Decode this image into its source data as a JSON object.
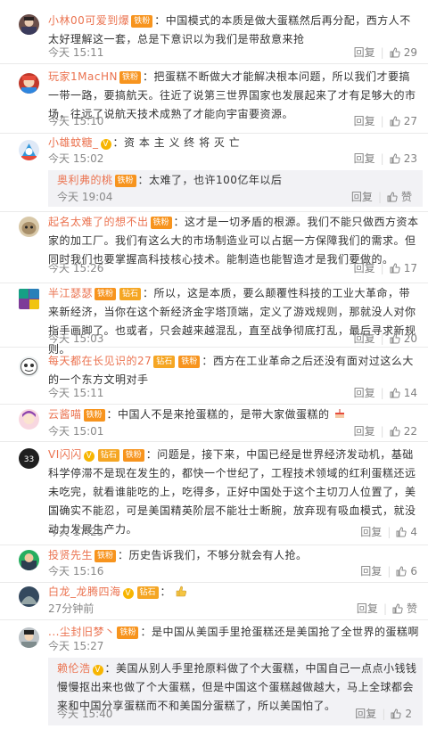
{
  "like_label": "赞",
  "reply_label": "回复",
  "sep": "|",
  "comments": [
    {
      "user": "小林00可爱到爆",
      "badge": "铁粉",
      "text": "：中国模式的本质是做大蛋糕然后再分配，西方人不太好理解这一套，总是下意识以为我们是带敌意来抢",
      "time": "今天 15:11",
      "likes": "29"
    },
    {
      "user": "玩家1MacHN",
      "badge": "铁粉",
      "text": "：把蛋糕不断做大才能解决根本问题，所以我们才要搞一带一路，要搞航天。往近了说第三世界国家也发展起来了才有足够大的市场，往远了说航天技术成熟了才能向宇宙要资源。",
      "time": "今天 15:10",
      "likes": "27"
    },
    {
      "user": "小雄蚊糖_",
      "vip": "V",
      "text": "：资 本 主 义 终 将 灭 亡",
      "time": "今天 15:02",
      "likes": "23",
      "reply": {
        "user": "奥利弗的桃",
        "badge": "铁粉",
        "text": "：太难了，也许100亿年以后",
        "time": "今天 19:04",
        "likes": ""
      }
    },
    {
      "user": "起名太难了的想不出",
      "badge": "铁粉",
      "text": "：这才是一切矛盾的根源。我们不能只做西方资本家的加工厂。我们有这么大的市场制造业可以占据一方保障我们的需求。但同时我们也要掌握高科技核心技术。能制造也能智造才是我们要做的。",
      "time": "今天 15:26",
      "likes": "17"
    },
    {
      "user": "半江瑟瑟",
      "badge": "铁粉",
      "badge2": "钻石",
      "text": "：所以，这是本质，要么颠覆性科技的工业大革命，带来新经济，当你在这个新经济金字塔顶端，定义了游戏规则，那就没人对你指手画脚了。也或者，只会越来越混乱，直至战争彻底打乱，最后寻求新规则。",
      "time": "今天 15:03",
      "likes": "20"
    },
    {
      "user": "每天都在长见识的27",
      "badge": "钻石",
      "badge2": "铁粉",
      "text": "：西方在工业革命之后还没有面对过这么大的一个东方文明对手",
      "time": "今天 15:11",
      "likes": "14"
    },
    {
      "user": "云酱喵",
      "badge": "铁粉",
      "text": "：中国人不是来抢蛋糕的，是带大家做蛋糕的",
      "time": "今天 15:01",
      "likes": "22"
    },
    {
      "user": "VI闪闪",
      "vip": "V",
      "badge": "钻石",
      "badge2": "铁粉",
      "text": "：问题是，接下来，中国已经是世界经济发动机，基础科学停滞不是现在发生的，都快一个世纪了，工程技术领域的红利蛋糕还远未吃完，就看谁能吃的上，吃得多，正好中国处于这个主切刀人位置了，美国确实不能忍，可是美国精英阶层不能壮士断腕，放弃现有吸血模式，就没动力发展生产力。",
      "time": "今天 17:25",
      "likes": "4"
    },
    {
      "user": "投贤先生",
      "badge": "铁粉",
      "text": "：历史告诉我们，不够分就会有人抢。",
      "time": "今天 15:16",
      "likes": "6"
    },
    {
      "user": "白龙_龙腾四海",
      "vip": "V",
      "badge": "钻石",
      "text": "：",
      "time": "27分钟前",
      "likes": ""
    },
    {
      "user": "...尘封旧梦丶",
      "badge": "铁粉",
      "text": "：是中国从美国手里抢蛋糕还是美国抢了全世界的蛋糕啊",
      "time": "今天 15:27",
      "likes": "",
      "reply": {
        "user": "赖伦浩",
        "vip": "V",
        "text": "：美国从别人手里抢原料做了个大蛋糕，中国自己一点点小钱钱慢慢抠出来也做了个大蛋糕，但是中国这个蛋糕越做越大，马上全球都会来和中国分享蛋糕而不和美国分蛋糕了，所以美国怕了。",
        "time": "今天 15:40",
        "likes": "2"
      }
    }
  ]
}
